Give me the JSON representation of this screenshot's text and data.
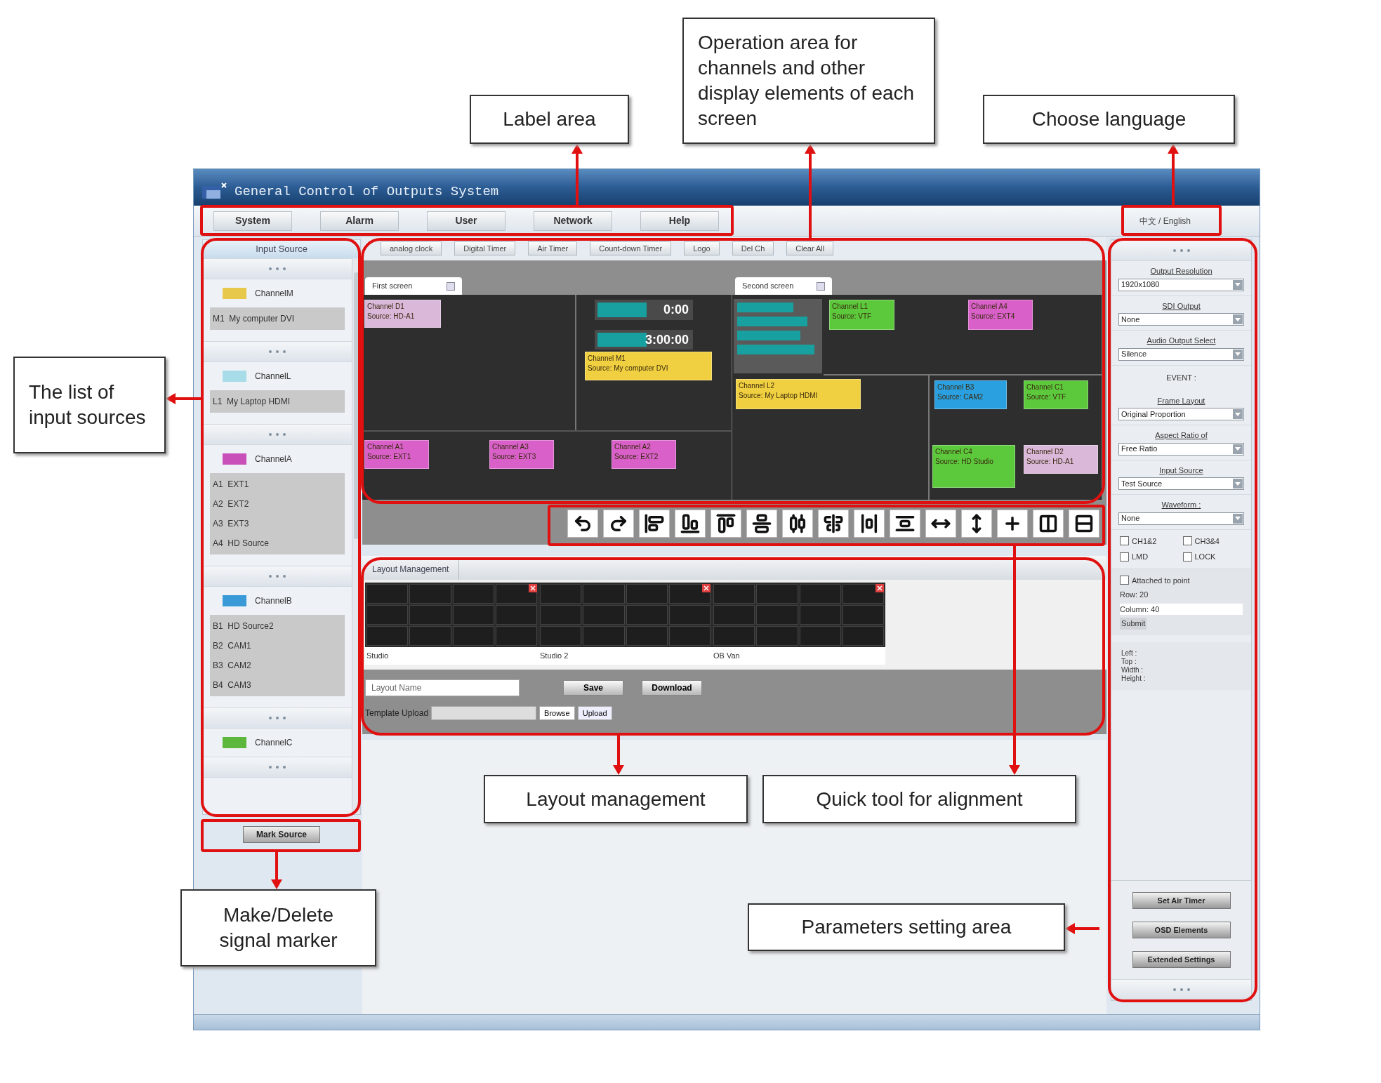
{
  "annotations": [
    {
      "text": "Label area"
    },
    {
      "text": "Operation area for channels and other display elements of each screen"
    },
    {
      "text": "Choose language"
    },
    {
      "text": "The list of input sources"
    },
    {
      "text": "Make/Delete signal marker"
    },
    {
      "text": "Layout management"
    },
    {
      "text": "Quick tool for alignment"
    },
    {
      "text": "Parameters setting area"
    }
  ],
  "window": {
    "title": "General Control of Outputs System"
  },
  "menu": [
    {
      "label": "System"
    },
    {
      "label": "Alarm"
    },
    {
      "label": "User"
    },
    {
      "label": "Network"
    },
    {
      "label": "Help"
    }
  ],
  "language": "中文 / English",
  "input_source": {
    "title": "Input Source",
    "channels": [
      {
        "name": "ChannelM",
        "color": "#e8c84a",
        "sources": [
          "M1  My computer DVI"
        ]
      },
      {
        "name": "ChannelL",
        "color": "#a8dce8",
        "sources": [
          "L1  My Laptop HDMI"
        ]
      },
      {
        "name": "ChannelA",
        "color": "#c850b8",
        "sources": [
          "A1  EXT1",
          "A2  EXT2",
          "A3  EXT3",
          "A4  HD Source"
        ]
      },
      {
        "name": "ChannelB",
        "color": "#3a9ad8",
        "sources": [
          "B1  HD Source2",
          "B2  CAM1",
          "B3  CAM2",
          "B4  CAM3"
        ]
      },
      {
        "name": "ChannelC",
        "color": "#5cb83c"
      }
    ]
  },
  "mark_source_button": "Mark Source",
  "tool_buttons": [
    "analog clock",
    "Digital Timer",
    "Air Timer",
    "Count-down Timer",
    "Logo",
    "Del Ch",
    "Clear All"
  ],
  "screens": [
    {
      "title": "First screen",
      "windows": [
        {
          "kind": "channel",
          "label": "Channel D1",
          "source": "Source: HD-A1",
          "color": "#d9b8d9"
        },
        {
          "kind": "timer",
          "text": "0:00"
        },
        {
          "kind": "timer",
          "text": "3:00:00"
        },
        {
          "kind": "channel",
          "label": "Channel M1",
          "source": "Source: My computer DVI",
          "color": "#f0d040"
        },
        {
          "kind": "channel",
          "label": "Channel A1",
          "source": "Source: EXT1",
          "color": "#d860c8"
        },
        {
          "kind": "channel",
          "label": "Channel A3",
          "source": "Source: EXT3",
          "color": "#d860c8"
        },
        {
          "kind": "channel",
          "label": "Channel A2",
          "source": "Source: EXT2",
          "color": "#d860c8"
        }
      ]
    },
    {
      "title": "Second screen",
      "windows": [
        {
          "kind": "clockpanel"
        },
        {
          "kind": "channel",
          "label": "Channel L1",
          "source": "Source: VTF",
          "color": "#5cc83c"
        },
        {
          "kind": "channel",
          "label": "Channel A4",
          "source": "Source: EXT4",
          "color": "#d860c8"
        },
        {
          "kind": "channel",
          "label": "Channel L2",
          "source": "Source: My Laptop HDMI",
          "color": "#f0d040"
        },
        {
          "kind": "channel",
          "label": "Channel B3",
          "source": "Source: CAM2",
          "color": "#2aa0e0"
        },
        {
          "kind": "channel",
          "label": "Channel C1",
          "source": "Source: VTF",
          "color": "#5cc83c"
        },
        {
          "kind": "channel",
          "label": "Channel C4",
          "source": "Source: HD Studio",
          "color": "#5cc83c"
        },
        {
          "kind": "channel",
          "label": "Channel D2",
          "source": "Source: HD-A1",
          "color": "#d9b8d9"
        }
      ]
    }
  ],
  "layout_management": {
    "title": "Layout Management",
    "layouts": [
      {
        "name": "Studio"
      },
      {
        "name": "Studio 2"
      },
      {
        "name": "OB Van"
      }
    ],
    "layout_name_placeholder": "Layout Name",
    "save_button": "Save",
    "download_button": "Download",
    "template_label": "Template Upload",
    "browse_button": "Browse",
    "upload_button": "Upload"
  },
  "parameters": {
    "selects": [
      {
        "label": "Output Resolution",
        "value": "1920x1080"
      },
      {
        "label": "SDI Output",
        "value": "None"
      },
      {
        "label": "Audio Output Select",
        "value": "Silence"
      }
    ],
    "event_label": "EVENT :",
    "event_selects": [
      {
        "label": "Frame Layout",
        "value": "Original Proportion"
      },
      {
        "label": "Aspect Ratio of",
        "value": "Free Ratio"
      },
      {
        "label": "Input Source",
        "value": "Test Source"
      },
      {
        "label": "Waveform :",
        "value": "None"
      }
    ],
    "checkboxes": [
      {
        "label": "CH1&2",
        "checked": false
      },
      {
        "label": "CH3&4",
        "checked": false
      },
      {
        "label": "LMD",
        "checked": false
      },
      {
        "label": "LOCK",
        "checked": false
      }
    ],
    "attach": {
      "label": "Attached to point",
      "checked": false
    },
    "row": "Row: 20",
    "column": "Column: 40",
    "submit": "Submit",
    "geometry": [
      "Left :",
      "Top :",
      "Width :",
      "Height :"
    ],
    "buttons": [
      "Set Air Timer",
      "OSD Elements",
      "Extended Settings"
    ]
  }
}
